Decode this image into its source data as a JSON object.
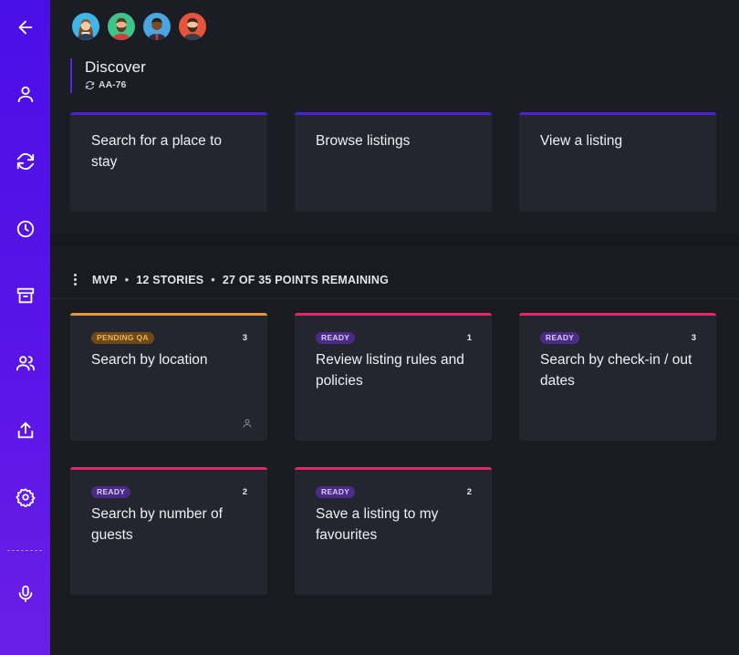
{
  "sidebar": {
    "items": [
      {
        "icon": "back-arrow-icon"
      },
      {
        "icon": "user-icon"
      },
      {
        "icon": "refresh-icon"
      },
      {
        "icon": "clock-icon"
      },
      {
        "icon": "archive-icon"
      },
      {
        "icon": "users-icon"
      },
      {
        "icon": "share-icon"
      },
      {
        "icon": "settings-gear-icon"
      },
      {
        "icon": "microphone-icon"
      }
    ]
  },
  "avatars": [
    "woman-avatar",
    "bearded-man-avatar",
    "man-suit-avatar",
    "redhead-man-avatar"
  ],
  "epic": {
    "title": "Discover",
    "id": "AA-76"
  },
  "features": [
    {
      "title": "Search for a place to stay"
    },
    {
      "title": "Browse listings"
    },
    {
      "title": "View a listing"
    }
  ],
  "release": {
    "name": "MVP",
    "stories": "12 STORIES",
    "points": "27 OF 35 POINTS REMAINING"
  },
  "stories": [
    {
      "status": "PENDING QA",
      "points": "3",
      "title": "Search by location",
      "status_color": "#f0b35b",
      "bar_color": "#e69a2e"
    },
    {
      "status": "READY",
      "points": "1",
      "title": "Review listing rules and policies",
      "status_color": "#d9c9ff",
      "bar_color": "#e0286b"
    },
    {
      "status": "READY",
      "points": "3",
      "title": "Search by check-in / out dates",
      "status_color": "#d9c9ff",
      "bar_color": "#e0286b"
    },
    {
      "status": "READY",
      "points": "2",
      "title": "Search by number of guests",
      "status_color": "#d9c9ff",
      "bar_color": "#e0286b"
    },
    {
      "status": "READY",
      "points": "2",
      "title": "Save a listing to my favourites",
      "status_color": "#d9c9ff",
      "bar_color": "#e0286b"
    }
  ],
  "colors": {
    "sidebar": "#4a0fe6",
    "background": "#1a1c23",
    "card": "#23262f",
    "feature_bar": "#4c1fd8",
    "ready_bar": "#e0286b",
    "pending_bar": "#e69a2e"
  }
}
